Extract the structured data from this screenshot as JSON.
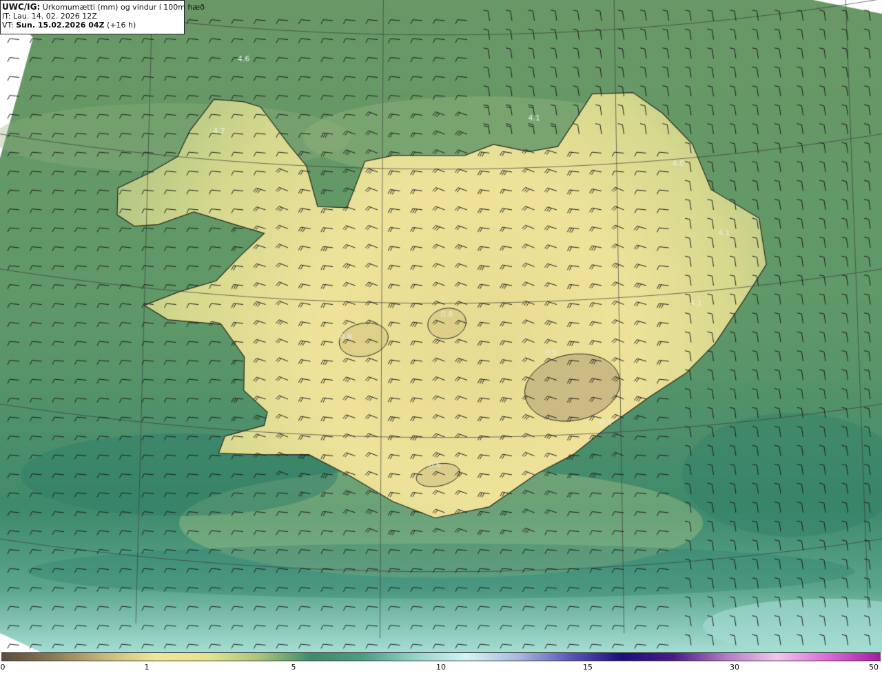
{
  "header": {
    "model": "UWC/IG:",
    "product": "Úrkomumætti (mm) og vindur í 100m hæð",
    "it_label": "IT:",
    "it_value": "Lau. 14. 02. 2026 12Z",
    "vt_label": "VT:",
    "vt_value": "Sun. 15.02.2026 04Z",
    "lead": "(+16 h)"
  },
  "legend": {
    "ticks": [
      "0",
      "1",
      "5",
      "10",
      "15",
      "30",
      "50"
    ],
    "colors": [
      "#5c4b3a",
      "#8a7a55",
      "#c9b97a",
      "#efe79a",
      "#e3e48f",
      "#a9c47c",
      "#3f8a6a",
      "#4f9c86",
      "#96d3c9",
      "#d3f3f4",
      "#a9b9de",
      "#5a57b8",
      "#1d0e7c",
      "#4a1e86",
      "#b37bc4",
      "#f0c6ea",
      "#d86ad6",
      "#a51b9e"
    ]
  },
  "map": {
    "palette": {
      "sea": "#5e9464",
      "sea_dark": "#2f7b66",
      "sea_light": "#a6ded4",
      "land": "#efe39a",
      "land_high": "#c2b07e",
      "coast": "#2a2a22",
      "barb": "#1c1c1c",
      "grid": "#3c3c3c"
    },
    "value_labels": [
      {
        "text": "4.6",
        "lon": -22.4,
        "lat": 66.75
      },
      {
        "text": "4.7",
        "lon": -22.8,
        "lat": 66.2
      },
      {
        "text": "4.1",
        "lon": -17.4,
        "lat": 66.35
      },
      {
        "text": "4.0",
        "lon": -14.95,
        "lat": 65.95
      },
      {
        "text": "4.1",
        "lon": -14.2,
        "lat": 65.4
      },
      {
        "text": "4.1",
        "lon": -14.7,
        "lat": 64.9
      },
      {
        "text": "0.8",
        "lon": -20.6,
        "lat": 64.72
      },
      {
        "text": "0.8",
        "lon": -18.9,
        "lat": 64.9
      },
      {
        "text": "0.5",
        "lon": -17.15,
        "lat": 64.6
      },
      {
        "text": "0.1",
        "lon": -16.25,
        "lat": 64.06
      },
      {
        "text": "0.6",
        "lon": -19.1,
        "lat": 63.78
      }
    ]
  }
}
